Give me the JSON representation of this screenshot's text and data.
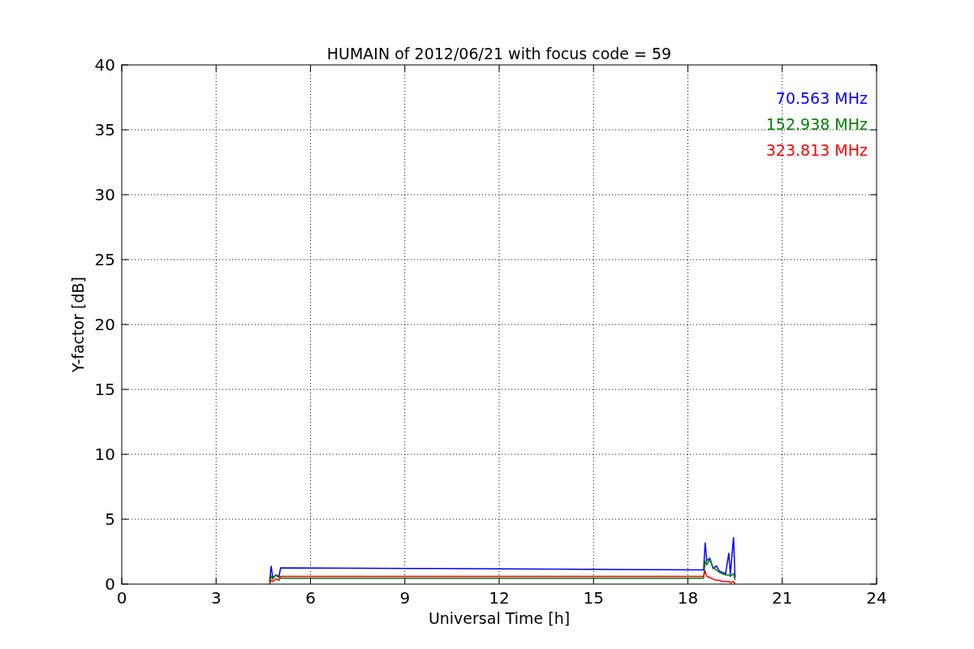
{
  "chart_data": {
    "type": "line",
    "title": "HUMAIN of 2012/06/21 with focus code = 59",
    "xlabel": "Universal Time [h]",
    "ylabel": "Y-factor [dB]",
    "x": [
      4.7,
      4.75,
      4.8,
      4.9,
      5.0,
      5.05,
      10,
      18.5,
      18.55,
      18.6,
      18.7,
      18.8,
      18.9,
      19.0,
      19.1,
      19.2,
      19.3,
      19.35,
      19.45,
      19.5
    ],
    "series": [
      {
        "name": "70.563 MHz",
        "color": "#0000ff",
        "values": [
          0.2,
          1.4,
          0.5,
          0.7,
          0.6,
          1.25,
          1.2,
          1.1,
          3.2,
          1.8,
          2.0,
          1.2,
          1.4,
          1.0,
          0.9,
          0.8,
          2.4,
          0.7,
          3.6,
          0.5
        ]
      },
      {
        "name": "152.938 MHz",
        "color": "#008000",
        "values": [
          0.1,
          0.6,
          0.4,
          0.7,
          0.5,
          0.45,
          0.45,
          0.45,
          1.8,
          1.5,
          1.9,
          1.3,
          1.1,
          0.9,
          0.8,
          0.7,
          0.7,
          0.6,
          0.8,
          0.3
        ]
      },
      {
        "name": "323.813 MHz",
        "color": "#ff0000",
        "values": [
          0.0,
          0.3,
          0.2,
          0.4,
          0.3,
          0.6,
          0.6,
          0.6,
          1.0,
          0.6,
          0.5,
          0.4,
          0.3,
          0.3,
          0.2,
          0.2,
          0.2,
          0.1,
          0.2,
          0.0
        ]
      }
    ],
    "grid": true,
    "xlim": [
      0,
      24
    ],
    "ylim": [
      0,
      40
    ],
    "xticks": [
      0,
      3,
      6,
      9,
      12,
      15,
      18,
      21,
      24
    ],
    "yticks": [
      0,
      5,
      10,
      15,
      20,
      25,
      30,
      35,
      40
    ]
  }
}
